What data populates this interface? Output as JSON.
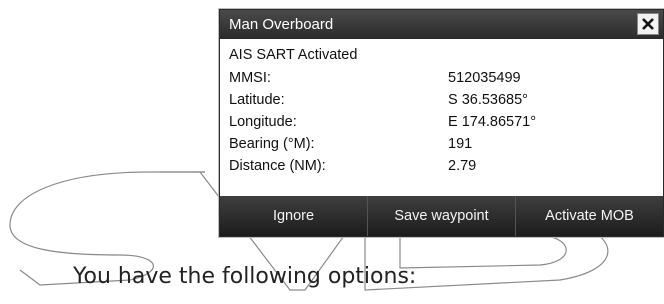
{
  "dialog": {
    "title": "Man Overboard",
    "headline": "AIS SART Activated",
    "rows": [
      {
        "label": "MMSI:",
        "value": "512035499"
      },
      {
        "label": "Latitude:",
        "value": "S  36.53685°"
      },
      {
        "label": "Longitude:",
        "value": "E 174.86571°"
      },
      {
        "label": "Bearing (°M):",
        "value": "191"
      },
      {
        "label": "Distance (NM):",
        "value": "2.79"
      }
    ],
    "buttons": {
      "ignore": "Ignore",
      "save_waypoint": "Save waypoint",
      "activate_mob": "Activate MOB"
    }
  },
  "caption": "You have the following options:",
  "watermark_text": "SVB",
  "colors": {
    "titlebar": "#2b2b2b",
    "buttonbar": "#1c1c1c",
    "text": "#111111"
  }
}
